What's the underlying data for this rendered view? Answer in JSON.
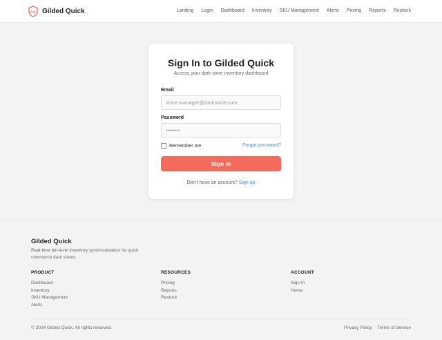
{
  "header": {
    "brand": "Gilded Quick",
    "logo_text": "GQ",
    "nav": [
      "Landing",
      "Login",
      "Dashboard",
      "Inventory",
      "SKU Management",
      "Alerts",
      "Pricing",
      "Reports",
      "Restock"
    ]
  },
  "login": {
    "title": "Sign In to Gilded Quick",
    "subtitle": "Access your dark store inventory dashboard",
    "email_label": "Email",
    "email_placeholder": "store.manager@darkstore.com",
    "password_label": "Password",
    "password_placeholder": "••••••••",
    "remember_label": "Remember me",
    "remember_checked": false,
    "forgot_label": "Forgot password?",
    "submit_label": "Sign In",
    "signup_prompt": "Don't have an account?",
    "signup_label": "Sign up"
  },
  "footer": {
    "brand": "Gilded Quick",
    "description": "Real-time bin-level inventory synchronization for quick commerce dark stores.",
    "columns": [
      {
        "title": "PRODUCT",
        "links": [
          "Dashboard",
          "Inventory",
          "SKU Management",
          "Alerts"
        ]
      },
      {
        "title": "RESOURCES",
        "links": [
          "Pricing",
          "Reports",
          "Restock"
        ]
      },
      {
        "title": "ACCOUNT",
        "links": [
          "Sign In",
          "Home"
        ]
      }
    ],
    "copyright": "© 2024 Gilded Quick. All rights reserved.",
    "legal": [
      "Privacy Policy",
      "Terms of Service"
    ]
  },
  "colors": {
    "accent": "#f26b5b",
    "link": "#4a90d9",
    "background": "#f3f3f3"
  }
}
